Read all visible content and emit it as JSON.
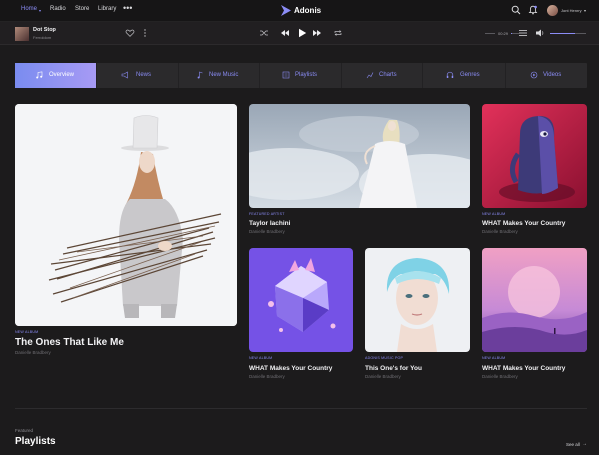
{
  "nav": {
    "home": "Home",
    "radio": "Radio",
    "store": "Store",
    "library": "Library",
    "more": "•••",
    "logo": "Adonis",
    "user": "Jont Henrry",
    "accent": "#8b8cf6"
  },
  "player": {
    "title": "Dot Stop",
    "artist": "Ferroldom",
    "time": "00:29",
    "progress": 0.03,
    "volume": 0.7
  },
  "tabs": [
    {
      "label": "Overview",
      "icon": "disc-icon"
    },
    {
      "label": "News",
      "icon": "megaphone-icon"
    },
    {
      "label": "New Music",
      "icon": "music-note-icon"
    },
    {
      "label": "Playlists",
      "icon": "playlist-icon"
    },
    {
      "label": "Charts",
      "icon": "chart-icon"
    },
    {
      "label": "Genres",
      "icon": "headphones-icon"
    },
    {
      "label": "Videos",
      "icon": "video-icon"
    }
  ],
  "cards": {
    "main": {
      "kicker": "New Album",
      "title": "The Ones That Like Me",
      "artist": "Danielle Bradbery"
    },
    "featured": {
      "kicker": "Featured Artist",
      "title": "Taylor Iachini",
      "artist": "Danielle Bradbery"
    },
    "red": {
      "kicker": "New Album",
      "title": "WHAT Makes Your Country",
      "artist": "Danielle Bradbery"
    },
    "purple": {
      "kicker": "New Album",
      "title": "WHAT Makes Your Country",
      "artist": "Danielle Bradbery"
    },
    "blue": {
      "kicker": "Adonis Music Pop",
      "title": "This One's for You",
      "artist": "Danielle Bradbery"
    },
    "pink": {
      "kicker": "New Album",
      "title": "WHAT Makes Your Country",
      "artist": "Danielle Bradbery"
    }
  },
  "section": {
    "featured_label": "Featured",
    "title": "Playlists",
    "see_all": "See all"
  }
}
